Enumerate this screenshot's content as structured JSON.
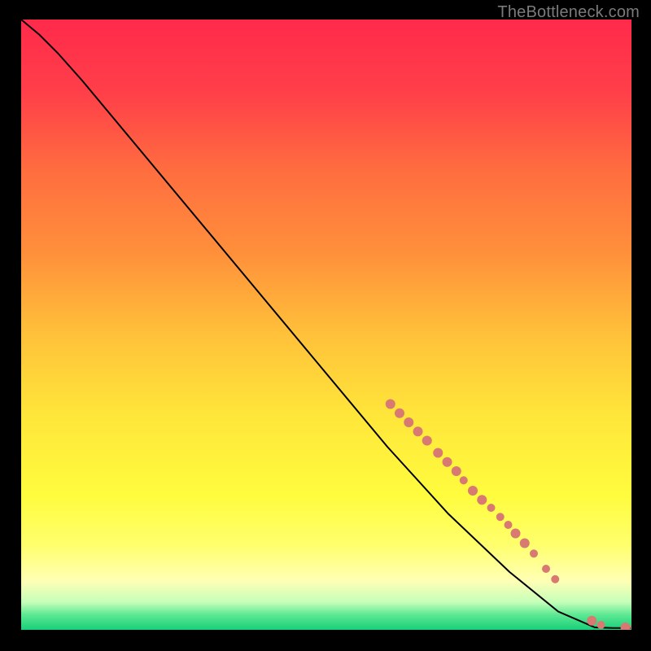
{
  "watermark": "TheBottleneck.com",
  "colors": {
    "dot_fill": "#d87a72",
    "dot_stroke": "#a65550",
    "line": "#000000"
  },
  "chart_data": {
    "type": "line",
    "title": "",
    "xlabel": "",
    "ylabel": "",
    "xlim": [
      0,
      100
    ],
    "ylim": [
      0,
      100
    ],
    "curve": [
      {
        "x": 0,
        "y": 100
      },
      {
        "x": 3,
        "y": 97.5
      },
      {
        "x": 6,
        "y": 94.5
      },
      {
        "x": 10,
        "y": 90
      },
      {
        "x": 20,
        "y": 78
      },
      {
        "x": 30,
        "y": 66
      },
      {
        "x": 40,
        "y": 54
      },
      {
        "x": 50,
        "y": 42
      },
      {
        "x": 60,
        "y": 30
      },
      {
        "x": 70,
        "y": 19
      },
      {
        "x": 80,
        "y": 9.5
      },
      {
        "x": 88,
        "y": 3
      },
      {
        "x": 94,
        "y": 0.4
      },
      {
        "x": 97,
        "y": 0.3
      },
      {
        "x": 100,
        "y": 0.3
      }
    ],
    "series": [
      {
        "name": "points",
        "points": [
          {
            "x": 60.5,
            "y": 37.0,
            "r": 6
          },
          {
            "x": 62.0,
            "y": 35.5,
            "r": 6
          },
          {
            "x": 63.5,
            "y": 34.0,
            "r": 6
          },
          {
            "x": 65.0,
            "y": 32.5,
            "r": 6
          },
          {
            "x": 66.5,
            "y": 31.0,
            "r": 6
          },
          {
            "x": 68.3,
            "y": 29.0,
            "r": 6
          },
          {
            "x": 69.8,
            "y": 27.5,
            "r": 6
          },
          {
            "x": 71.3,
            "y": 26.0,
            "r": 6
          },
          {
            "x": 72.5,
            "y": 24.5,
            "r": 5
          },
          {
            "x": 74.0,
            "y": 22.8,
            "r": 6
          },
          {
            "x": 75.5,
            "y": 21.3,
            "r": 6
          },
          {
            "x": 77.0,
            "y": 20.0,
            "r": 5
          },
          {
            "x": 78.5,
            "y": 18.5,
            "r": 5
          },
          {
            "x": 79.8,
            "y": 17.2,
            "r": 5
          },
          {
            "x": 81.0,
            "y": 15.8,
            "r": 6
          },
          {
            "x": 82.5,
            "y": 14.2,
            "r": 6
          },
          {
            "x": 84.0,
            "y": 12.5,
            "r": 5
          },
          {
            "x": 86.0,
            "y": 10.0,
            "r": 5
          },
          {
            "x": 87.5,
            "y": 8.3,
            "r": 5
          },
          {
            "x": 93.5,
            "y": 1.5,
            "r": 6
          },
          {
            "x": 95.0,
            "y": 0.8,
            "r": 5
          },
          {
            "x": 99.0,
            "y": 0.4,
            "r": 6
          },
          {
            "x": 100.5,
            "y": 0.4,
            "r": 5
          }
        ]
      }
    ]
  },
  "gradient_stops": [
    {
      "offset": 0.0,
      "color": "#ff2a4b"
    },
    {
      "offset": 0.12,
      "color": "#ff3f49"
    },
    {
      "offset": 0.25,
      "color": "#ff6e3f"
    },
    {
      "offset": 0.38,
      "color": "#ff8f3b"
    },
    {
      "offset": 0.52,
      "color": "#ffc23a"
    },
    {
      "offset": 0.65,
      "color": "#ffe63a"
    },
    {
      "offset": 0.78,
      "color": "#fffc3e"
    },
    {
      "offset": 0.86,
      "color": "#ffff6c"
    },
    {
      "offset": 0.92,
      "color": "#ffffb5"
    },
    {
      "offset": 0.955,
      "color": "#c4ffb9"
    },
    {
      "offset": 0.975,
      "color": "#5ee893"
    },
    {
      "offset": 1.0,
      "color": "#18d07a"
    }
  ]
}
